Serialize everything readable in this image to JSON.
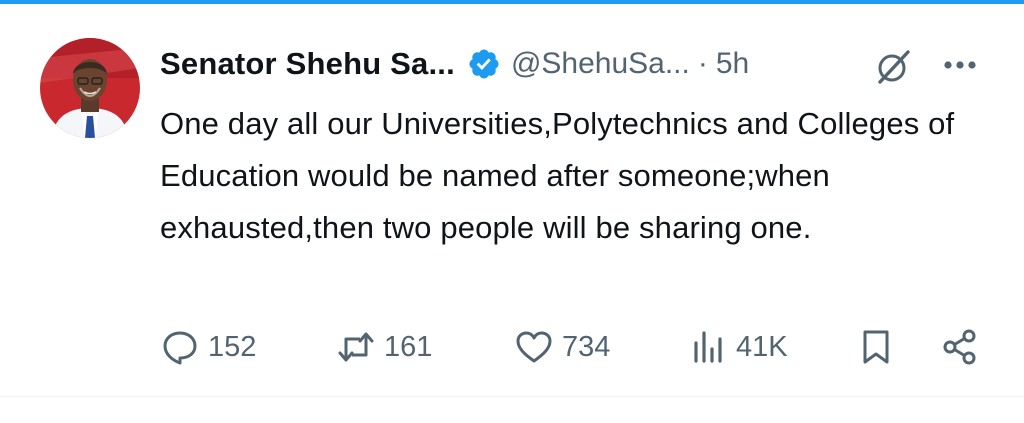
{
  "author": {
    "display_name": "Senator Shehu Sa...",
    "handle": "@ShehuSa...",
    "separator": "·",
    "timestamp": "5h",
    "verified": true,
    "verified_color": "#1d9bf0"
  },
  "tweet": {
    "text": "One day all our Universities,Polytechnics and Colleges of Education would be named after someone;when exhausted,then two people will be sharing one."
  },
  "actions": {
    "replies": "152",
    "reposts": "161",
    "likes": "734",
    "views": "41K"
  },
  "icons": {
    "reply": "speech-bubble-icon",
    "repost": "repost-arrows-icon",
    "like": "heart-icon",
    "views": "bar-chart-icon",
    "bookmark": "bookmark-icon",
    "share": "share-icon",
    "grok": "grok-slash-icon",
    "more": "more-dots-icon"
  },
  "colors": {
    "text_primary": "#0f1419",
    "text_secondary": "#536471",
    "accent": "#1d9bf0"
  }
}
